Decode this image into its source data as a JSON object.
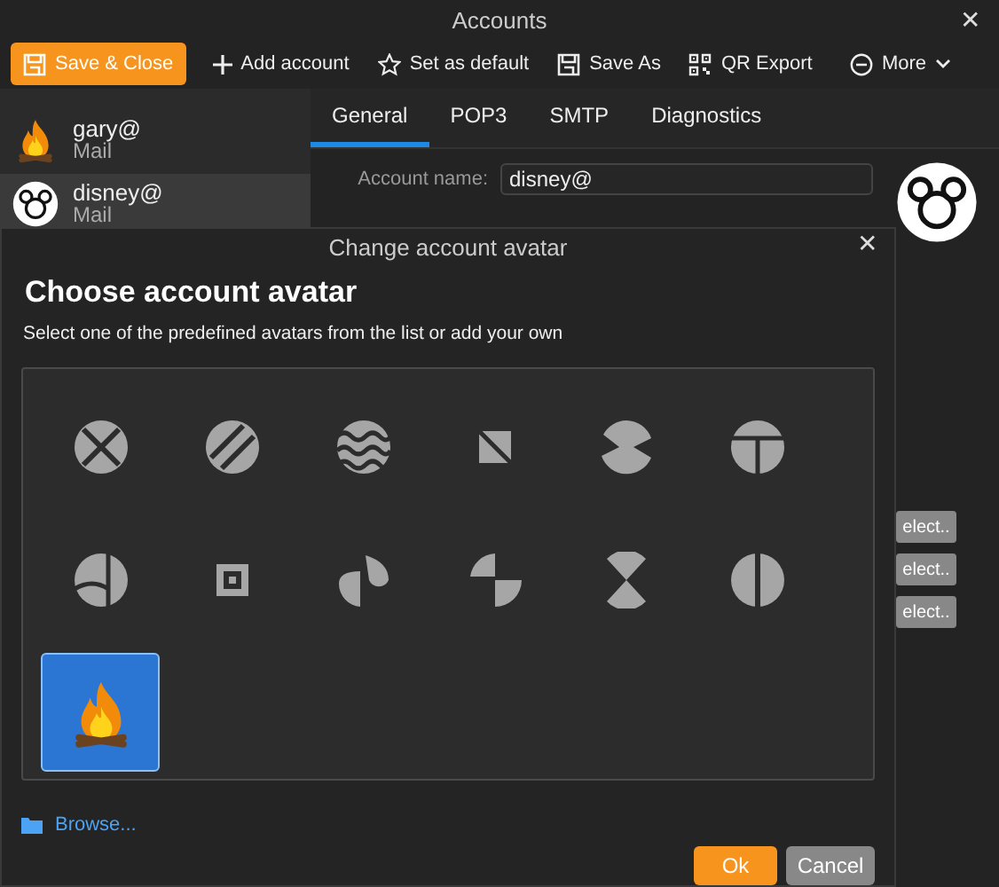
{
  "window": {
    "title": "Accounts",
    "close": "✕"
  },
  "toolbar": [
    {
      "kind": "save",
      "label": "Save & Close",
      "primary": true
    },
    {
      "kind": "plus",
      "label": "Add account",
      "primary": false
    },
    {
      "kind": "star",
      "label": "Set as default",
      "primary": false
    },
    {
      "kind": "save",
      "label": "Save As",
      "primary": false
    },
    {
      "kind": "qr",
      "label": "QR Export",
      "primary": false
    },
    {
      "kind": "more",
      "label": "More",
      "primary": false
    }
  ],
  "accounts": [
    {
      "email": "gary@",
      "type": "Mail",
      "kind": "flame",
      "selected": false
    },
    {
      "email": "disney@",
      "type": "Mail",
      "kind": "mouse",
      "selected": true
    }
  ],
  "tabs": [
    {
      "label": "General",
      "selected": true
    },
    {
      "label": "POP3",
      "selected": false
    },
    {
      "label": "SMTP",
      "selected": false
    },
    {
      "label": "Diagnostics",
      "selected": false
    }
  ],
  "account_name": {
    "label": "Account name:",
    "value": "disney@"
  },
  "side_buttons": [
    "elect..",
    "elect..",
    "elect.."
  ],
  "dialog": {
    "title": "Change account avatar",
    "close": "✕",
    "heading": "Choose account avatar",
    "description": "Select one of the predefined avatars from the list or add your own",
    "avatars": [
      {
        "kind": "cross",
        "selected": false
      },
      {
        "kind": "stripes",
        "selected": false
      },
      {
        "kind": "waves",
        "selected": false
      },
      {
        "kind": "triangle",
        "selected": false
      },
      {
        "kind": "zigzag",
        "selected": false
      },
      {
        "kind": "tee",
        "selected": false
      },
      {
        "kind": "arc",
        "selected": false
      },
      {
        "kind": "square",
        "selected": false
      },
      {
        "kind": "petals",
        "selected": false
      },
      {
        "kind": "step",
        "selected": false
      },
      {
        "kind": "hourglass",
        "selected": false
      },
      {
        "kind": "split",
        "selected": false
      },
      {
        "kind": "flame",
        "selected": true
      }
    ],
    "browse": "Browse...",
    "ok": "Ok",
    "cancel": "Cancel"
  }
}
